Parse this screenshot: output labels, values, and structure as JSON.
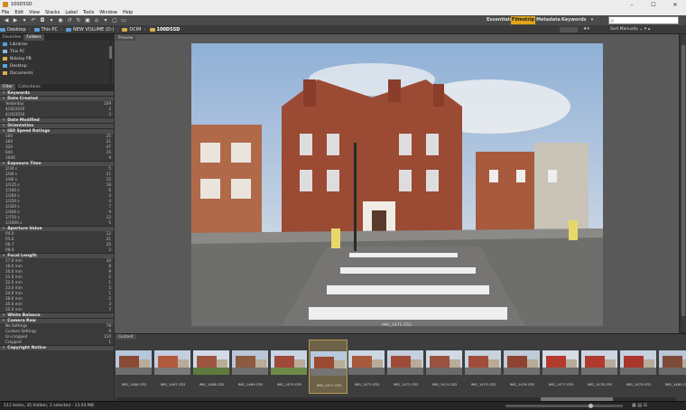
{
  "window": {
    "title": "100D5SD"
  },
  "menu": [
    "File",
    "Edit",
    "View",
    "Stacks",
    "Label",
    "Tools",
    "Window",
    "Help"
  ],
  "workspaces": [
    "Essentials",
    "Filmstrip",
    "Metadata",
    "Keywords"
  ],
  "active_workspace": "Filmstrip",
  "search": {
    "placeholder": "ρ"
  },
  "sort": {
    "label": "Sort Manually"
  },
  "path": [
    "Desktop",
    "This PC",
    "NEW VOLUME (D:)",
    "DCIM",
    "100D5SD"
  ],
  "left": {
    "tabs": [
      "Favorites",
      "Folders"
    ],
    "folders": [
      "Libraries",
      "This PC",
      "Nikolay PB",
      "Desktop",
      "Documents"
    ],
    "filter_tabs": [
      "Filter",
      "Collections"
    ],
    "sections": [
      {
        "title": "Keywords",
        "items": []
      },
      {
        "title": "Date Created",
        "items": [
          {
            "label": "Yesterday",
            "count": "109"
          },
          {
            "label": "4/26/2016",
            "count": "2"
          },
          {
            "label": "4/20/2016",
            "count": "3"
          }
        ]
      },
      {
        "title": "Date Modified",
        "items": []
      },
      {
        "title": "Orientation",
        "items": []
      },
      {
        "title": "ISO Speed Ratings",
        "items": [
          {
            "label": "100",
            "count": "25"
          },
          {
            "label": "160",
            "count": "21"
          },
          {
            "label": "320",
            "count": "47"
          },
          {
            "label": "640",
            "count": "15"
          },
          {
            "label": "1000",
            "count": "9"
          }
        ]
      },
      {
        "title": "Exposure Time",
        "items": [
          {
            "label": "1/30 s",
            "count": "5"
          },
          {
            "label": "1/60 s",
            "count": "21"
          },
          {
            "label": "1/80 s",
            "count": "15"
          },
          {
            "label": "1/125 s",
            "count": "18"
          },
          {
            "label": "1/160 s",
            "count": "6"
          },
          {
            "label": "1/200 s",
            "count": "3"
          },
          {
            "label": "1/250 s",
            "count": "4"
          },
          {
            "label": "1/320 s",
            "count": "7"
          },
          {
            "label": "1/400 s",
            "count": "9"
          },
          {
            "label": "1/750 s",
            "count": "12"
          },
          {
            "label": "1/1000 s",
            "count": "5"
          }
        ]
      },
      {
        "title": "Aperture Value",
        "items": [
          {
            "label": "f/4.0",
            "count": "12"
          },
          {
            "label": "f/5.6",
            "count": "21"
          },
          {
            "label": "f/6.7",
            "count": "20"
          },
          {
            "label": "f/8.0",
            "count": "2"
          }
        ]
      },
      {
        "title": "Focal Length",
        "items": [
          {
            "label": "17.0 mm",
            "count": "34"
          },
          {
            "label": "18.0 mm",
            "count": "8"
          },
          {
            "label": "20.0 mm",
            "count": "9"
          },
          {
            "label": "21.0 mm",
            "count": "2"
          },
          {
            "label": "22.0 mm",
            "count": "1"
          },
          {
            "label": "23.0 mm",
            "count": "5"
          },
          {
            "label": "24.0 mm",
            "count": "1"
          },
          {
            "label": "28.0 mm",
            "count": "2"
          },
          {
            "label": "35.0 mm",
            "count": "3"
          },
          {
            "label": "55.0 mm",
            "count": "7"
          }
        ]
      },
      {
        "title": "White Balance",
        "items": []
      },
      {
        "title": "Camera Raw",
        "items": [
          {
            "label": "No Settings",
            "count": "78"
          },
          {
            "label": "Custom Settings",
            "count": "9"
          },
          {
            "label": "Un-cropped",
            "count": "110"
          },
          {
            "label": "Cropped",
            "count": "1"
          }
        ]
      },
      {
        "title": "Copyright Notice",
        "items": []
      }
    ]
  },
  "content": {
    "tab": "Preview",
    "caption": "IMG_1471.CR2"
  },
  "filmstrip": {
    "tab": "Content",
    "thumbs": [
      "IMG_1466.CR2",
      "IMG_1467.CR2",
      "IMG_1468.CR2",
      "IMG_1469.CR2",
      "IMG_1470.CR2",
      "IMG_1471.CR2",
      "IMG_1472.CR2",
      "IMG_1473.CR2",
      "IMG_1474.CR2",
      "IMG_1475.CR2",
      "IMG_1476.CR2",
      "IMG_1477.CR2",
      "IMG_1478.CR2",
      "IMG_1479.CR2",
      "IMG_1480.CR2"
    ],
    "selected_index": 5
  },
  "status": {
    "text": "111 items, 35 hidden, 1 selected - 13.93 MB"
  },
  "colors": {
    "accent": "#e0a51c",
    "toolbar": "#4a4a4a",
    "panel": "#383838",
    "content": "#595959"
  }
}
